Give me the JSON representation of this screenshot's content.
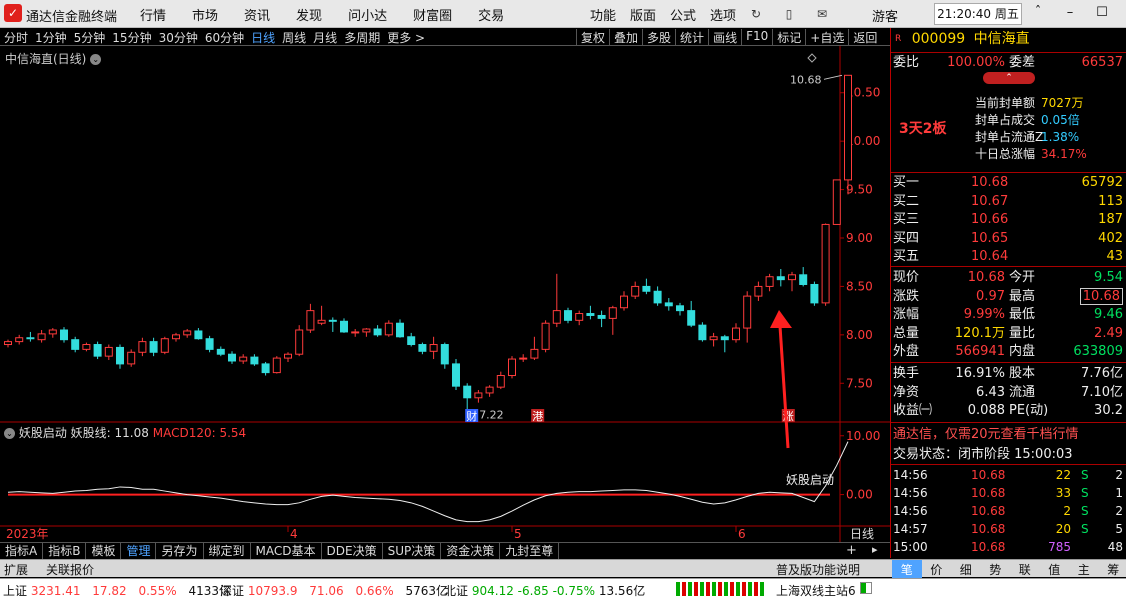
{
  "titlebar": {
    "app_title": "通达信金融终端",
    "menus": [
      "行情",
      "市场",
      "资讯",
      "发现",
      "问小达",
      "财富圈",
      "交易"
    ],
    "right_menus": [
      "功能",
      "版面",
      "公式",
      "选项"
    ],
    "guest": "游客",
    "clock": "21:20:40 周五"
  },
  "toolbar": {
    "periods": [
      "分时",
      "1分钟",
      "5分钟",
      "15分钟",
      "30分钟",
      "60分钟",
      "日线",
      "周线",
      "月线",
      "多周期",
      "更多 >"
    ],
    "active_period": "日线",
    "tools": [
      "复权",
      "叠加",
      "多股",
      "统计",
      "画线",
      "F10",
      "标记",
      "+自选",
      "返回"
    ]
  },
  "chart": {
    "title": "中信海直(日线)",
    "price_ticks": [
      "10.50",
      "10.00",
      "9.50",
      "9.00",
      "8.50",
      "8.00",
      "7.50"
    ],
    "high_label": "10.68",
    "low_label": "7.22",
    "event_tags": [
      "财",
      "港",
      "涨"
    ],
    "year_label": "2023年",
    "month_labels": [
      "4",
      "5",
      "6"
    ],
    "period_label": "日线"
  },
  "indicator": {
    "name": "妖股启动",
    "line_label": "妖股线: 11.08",
    "macd_label": "MACD120: 5.54",
    "ticks": [
      "10.00",
      "0.00"
    ],
    "annotation": "妖股启动"
  },
  "chart_data": {
    "type": "candlestick",
    "candles": [
      [
        7.9,
        7.95,
        7.87,
        7.93
      ],
      [
        7.93,
        8.0,
        7.9,
        7.97
      ],
      [
        7.97,
        8.03,
        7.93,
        7.96
      ],
      [
        7.95,
        8.05,
        7.92,
        8.01
      ],
      [
        8.01,
        8.07,
        7.97,
        8.05
      ],
      [
        8.05,
        8.08,
        7.92,
        7.95
      ],
      [
        7.95,
        7.98,
        7.82,
        7.85
      ],
      [
        7.85,
        7.92,
        7.83,
        7.9
      ],
      [
        7.9,
        7.93,
        7.75,
        7.78
      ],
      [
        7.78,
        7.9,
        7.74,
        7.87
      ],
      [
        7.87,
        7.9,
        7.65,
        7.7
      ],
      [
        7.7,
        7.85,
        7.67,
        7.82
      ],
      [
        7.82,
        7.97,
        7.78,
        7.93
      ],
      [
        7.93,
        7.97,
        7.78,
        7.82
      ],
      [
        7.82,
        7.98,
        7.8,
        7.96
      ],
      [
        7.96,
        8.02,
        7.93,
        8.0
      ],
      [
        8.0,
        8.06,
        7.97,
        8.04
      ],
      [
        8.04,
        8.07,
        7.95,
        7.96
      ],
      [
        7.96,
        7.99,
        7.82,
        7.85
      ],
      [
        7.85,
        7.88,
        7.78,
        7.8
      ],
      [
        7.8,
        7.83,
        7.7,
        7.73
      ],
      [
        7.73,
        7.8,
        7.7,
        7.77
      ],
      [
        7.77,
        7.8,
        7.68,
        7.7
      ],
      [
        7.7,
        7.72,
        7.58,
        7.61
      ],
      [
        7.61,
        7.78,
        7.6,
        7.76
      ],
      [
        7.76,
        7.82,
        7.72,
        7.8
      ],
      [
        7.8,
        8.1,
        7.78,
        8.05
      ],
      [
        8.05,
        8.32,
        8.02,
        8.25
      ],
      [
        8.12,
        8.3,
        8.1,
        8.15
      ],
      [
        8.15,
        8.18,
        8.03,
        8.14
      ],
      [
        8.14,
        8.17,
        8.02,
        8.03
      ],
      [
        8.03,
        8.06,
        7.98,
        8.03
      ],
      [
        8.03,
        8.07,
        7.98,
        8.06
      ],
      [
        8.06,
        8.1,
        7.98,
        8.0
      ],
      [
        8.0,
        8.15,
        7.98,
        8.12
      ],
      [
        8.12,
        8.16,
        7.97,
        7.98
      ],
      [
        7.98,
        8.02,
        7.88,
        7.9
      ],
      [
        7.9,
        7.92,
        7.8,
        7.83
      ],
      [
        7.83,
        7.98,
        7.75,
        7.9
      ],
      [
        7.9,
        7.92,
        7.65,
        7.7
      ],
      [
        7.7,
        7.75,
        7.43,
        7.47
      ],
      [
        7.47,
        7.5,
        7.22,
        7.35
      ],
      [
        7.35,
        7.43,
        7.3,
        7.4
      ],
      [
        7.4,
        7.48,
        7.36,
        7.46
      ],
      [
        7.46,
        7.62,
        7.44,
        7.58
      ],
      [
        7.58,
        7.78,
        7.55,
        7.75
      ],
      [
        7.75,
        7.8,
        7.72,
        7.76
      ],
      [
        7.76,
        7.98,
        7.74,
        7.85
      ],
      [
        7.85,
        8.15,
        7.82,
        8.12
      ],
      [
        8.12,
        8.63,
        8.08,
        8.25
      ],
      [
        8.25,
        8.28,
        8.12,
        8.15
      ],
      [
        8.15,
        8.25,
        8.1,
        8.22
      ],
      [
        8.22,
        8.3,
        8.16,
        8.2
      ],
      [
        8.2,
        8.25,
        8.08,
        8.17
      ],
      [
        8.17,
        8.3,
        8.0,
        8.28
      ],
      [
        8.28,
        8.45,
        8.25,
        8.4
      ],
      [
        8.4,
        8.55,
        8.37,
        8.5
      ],
      [
        8.5,
        8.58,
        8.42,
        8.45
      ],
      [
        8.45,
        8.5,
        8.3,
        8.33
      ],
      [
        8.33,
        8.38,
        8.25,
        8.3
      ],
      [
        8.3,
        8.33,
        8.2,
        8.25
      ],
      [
        8.25,
        8.35,
        8.08,
        8.1
      ],
      [
        8.1,
        8.13,
        7.93,
        7.95
      ],
      [
        7.95,
        8.02,
        7.88,
        7.98
      ],
      [
        7.98,
        8.0,
        7.82,
        7.95
      ],
      [
        7.95,
        8.12,
        7.92,
        8.07
      ],
      [
        8.07,
        8.45,
        7.92,
        8.4
      ],
      [
        8.4,
        8.55,
        8.35,
        8.5
      ],
      [
        8.5,
        8.63,
        8.45,
        8.6
      ],
      [
        8.6,
        8.68,
        8.5,
        8.57
      ],
      [
        8.57,
        8.65,
        8.45,
        8.62
      ],
      [
        8.62,
        8.7,
        8.5,
        8.52
      ],
      [
        8.52,
        8.55,
        8.3,
        8.33
      ],
      [
        8.33,
        9.15,
        8.3,
        9.14
      ],
      [
        9.14,
        9.6,
        9.2,
        9.6
      ],
      [
        9.6,
        10.68,
        9.45,
        10.68
      ]
    ],
    "indicator_line": [
      0.4,
      0.5,
      0.4,
      0.3,
      0.2,
      0.4,
      0.6,
      0.7,
      0.9,
      1.0,
      1.3,
      1.2,
      0.9,
      0.9,
      0.6,
      0.3,
      0.0,
      -0.2,
      -0.4,
      -0.6,
      -0.9,
      -1.2,
      -1.4,
      -1.6,
      -1.7,
      -1.7,
      -1.4,
      -0.8,
      -0.3,
      -0.1,
      -0.3,
      -0.5,
      -0.6,
      -0.7,
      -0.8,
      -1.0,
      -1.4,
      -2.0,
      -2.8,
      -3.6,
      -4.3,
      -4.6,
      -4.6,
      -4.3,
      -3.7,
      -2.8,
      -1.8,
      -0.9,
      -0.2,
      0.2,
      0.4,
      0.5,
      0.5,
      0.6,
      0.7,
      0.8,
      0.8,
      0.7,
      0.4,
      0.1,
      -0.3,
      -0.8,
      -1.3,
      -1.6,
      -1.4,
      -0.9,
      -0.3,
      0.2,
      0.4,
      0.3,
      0.2,
      -0.5,
      -1.2,
      1.5,
      5.0,
      9.0
    ],
    "macd_line": [
      0.0,
      0.0
    ],
    "ylim": [
      7.1,
      10.9
    ]
  },
  "quote": {
    "code": "000099",
    "name": "中信海直",
    "weibi_label": "委比",
    "weibi": "100.00%",
    "weicha_label": "委差",
    "weicha": "66537",
    "board_tag": "3天2板",
    "seal_rows": [
      {
        "label": "当前封单额",
        "value": "7027万",
        "color": "yellow"
      },
      {
        "label": "封单占成交",
        "value": "0.05倍",
        "color": "cyan"
      },
      {
        "label": "封单占流通Z",
        "value": "1.38%",
        "color": "cyan"
      },
      {
        "label": "十日总涨幅",
        "value": "34.17%",
        "color": "red"
      }
    ],
    "bids": [
      {
        "label": "买一",
        "price": "10.68",
        "vol": "65792"
      },
      {
        "label": "买二",
        "price": "10.67",
        "vol": "113"
      },
      {
        "label": "买三",
        "price": "10.66",
        "vol": "187"
      },
      {
        "label": "买四",
        "price": "10.65",
        "vol": "402"
      },
      {
        "label": "买五",
        "price": "10.64",
        "vol": "43"
      }
    ],
    "stats": [
      {
        "l1": "现价",
        "v1": "10.68",
        "c1": "red",
        "l2": "今开",
        "v2": "9.54",
        "c2": "green"
      },
      {
        "l1": "涨跌",
        "v1": "0.97",
        "c1": "red",
        "l2": "最高",
        "v2": "10.68",
        "c2": "red"
      },
      {
        "l1": "涨幅",
        "v1": "9.99%",
        "c1": "red",
        "l2": "最低",
        "v2": "9.46",
        "c2": "green"
      },
      {
        "l1": "总量",
        "v1": "120.1万",
        "c1": "yellow",
        "l2": "量比",
        "v2": "2.49",
        "c2": "red"
      },
      {
        "l1": "外盘",
        "v1": "566941",
        "c1": "red",
        "l2": "内盘",
        "v2": "633809",
        "c2": "green"
      }
    ],
    "fundamentals": [
      {
        "l1": "换手",
        "v1": "16.91%",
        "l2": "股本",
        "v2": "7.76亿"
      },
      {
        "l1": "净资",
        "v1": "6.43",
        "l2": "流通",
        "v2": "7.10亿"
      },
      {
        "l1": "收益㈠",
        "v1": "0.088",
        "l2": "PE(动)",
        "v2": "30.2"
      }
    ],
    "promo": "通达信，仅需20元查看千档行情",
    "trade_state": "交易状态：闭市阶段 15:00:03",
    "ticks": [
      {
        "time": "14:56",
        "price": "10.68",
        "vol": "22",
        "side": "S",
        "n": "2"
      },
      {
        "time": "14:56",
        "price": "10.68",
        "vol": "33",
        "side": "S",
        "n": "1"
      },
      {
        "time": "14:56",
        "price": "10.68",
        "vol": "2",
        "side": "S",
        "n": "2"
      },
      {
        "time": "14:57",
        "price": "10.68",
        "vol": "20",
        "side": "S",
        "n": "5"
      },
      {
        "time": "15:00",
        "price": "10.68",
        "vol": "785",
        "side": "",
        "n": "48"
      }
    ]
  },
  "bottom_tabs": [
    "指标A",
    "指标B",
    "模板",
    "管理",
    "另存为",
    "绑定到",
    "MACD基本",
    "DDE决策",
    "SUP决策",
    "资金决策",
    "九封至尊"
  ],
  "bottom_right": "+",
  "status": {
    "left": [
      "扩展",
      "关联报价"
    ],
    "right": "普及版功能说明",
    "quote_tabs": [
      "笔",
      "价",
      "细",
      "势",
      "联",
      "值",
      "主",
      "筹"
    ]
  },
  "indices": {
    "sh_label": "上证",
    "sh_val": "3231.41",
    "sh_chg": "17.82",
    "sh_pct": "0.55%",
    "sh_amt": "4133亿",
    "sz_label": "深证",
    "sz_val": "10793.9",
    "sz_chg": "71.06",
    "sz_pct": "0.66%",
    "sz_amt": "5763亿",
    "bz_label": "北证",
    "bz_val": "904.12",
    "bz_chg": "-6.85",
    "bz_pct": "-0.75%",
    "bz_amt": "13.56亿",
    "station": "上海双线主站6"
  }
}
